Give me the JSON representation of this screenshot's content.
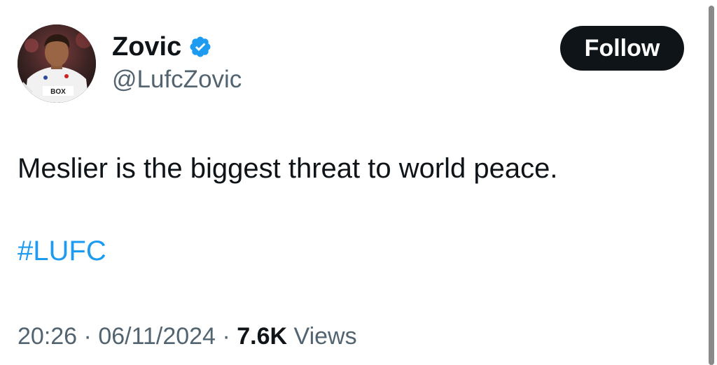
{
  "user": {
    "display_name": "Zovic",
    "handle": "@LufcZovic",
    "verified_icon": "verified-badge-icon",
    "avatar_jersey_text": "BOX"
  },
  "follow_button": {
    "label": "Follow"
  },
  "tweet": {
    "text": "Meslier is the biggest threat to world peace.",
    "hashtag": "#LUFC"
  },
  "meta": {
    "time": "20:26",
    "separator": "·",
    "date": "06/11/2024",
    "views_count": "7.6K",
    "views_label": "Views"
  },
  "colors": {
    "text_primary": "#0f1419",
    "text_secondary": "#536471",
    "link": "#1d9bf0",
    "verified": "#1d9bf0",
    "button_bg": "#0f1419",
    "button_text": "#ffffff"
  }
}
